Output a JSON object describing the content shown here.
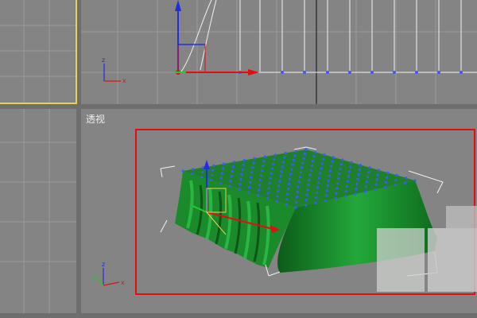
{
  "viewports": {
    "perspective": {
      "label": "透视"
    }
  },
  "axis_labels": {
    "x": "x",
    "y": "y",
    "z": "z"
  },
  "colors": {
    "viewport_bg": "#848484",
    "active_outline": "#e8d44a",
    "selection_frame": "#e01010",
    "mesh_green": "#1a8a2a",
    "vertex_blue": "#3a5cff"
  }
}
